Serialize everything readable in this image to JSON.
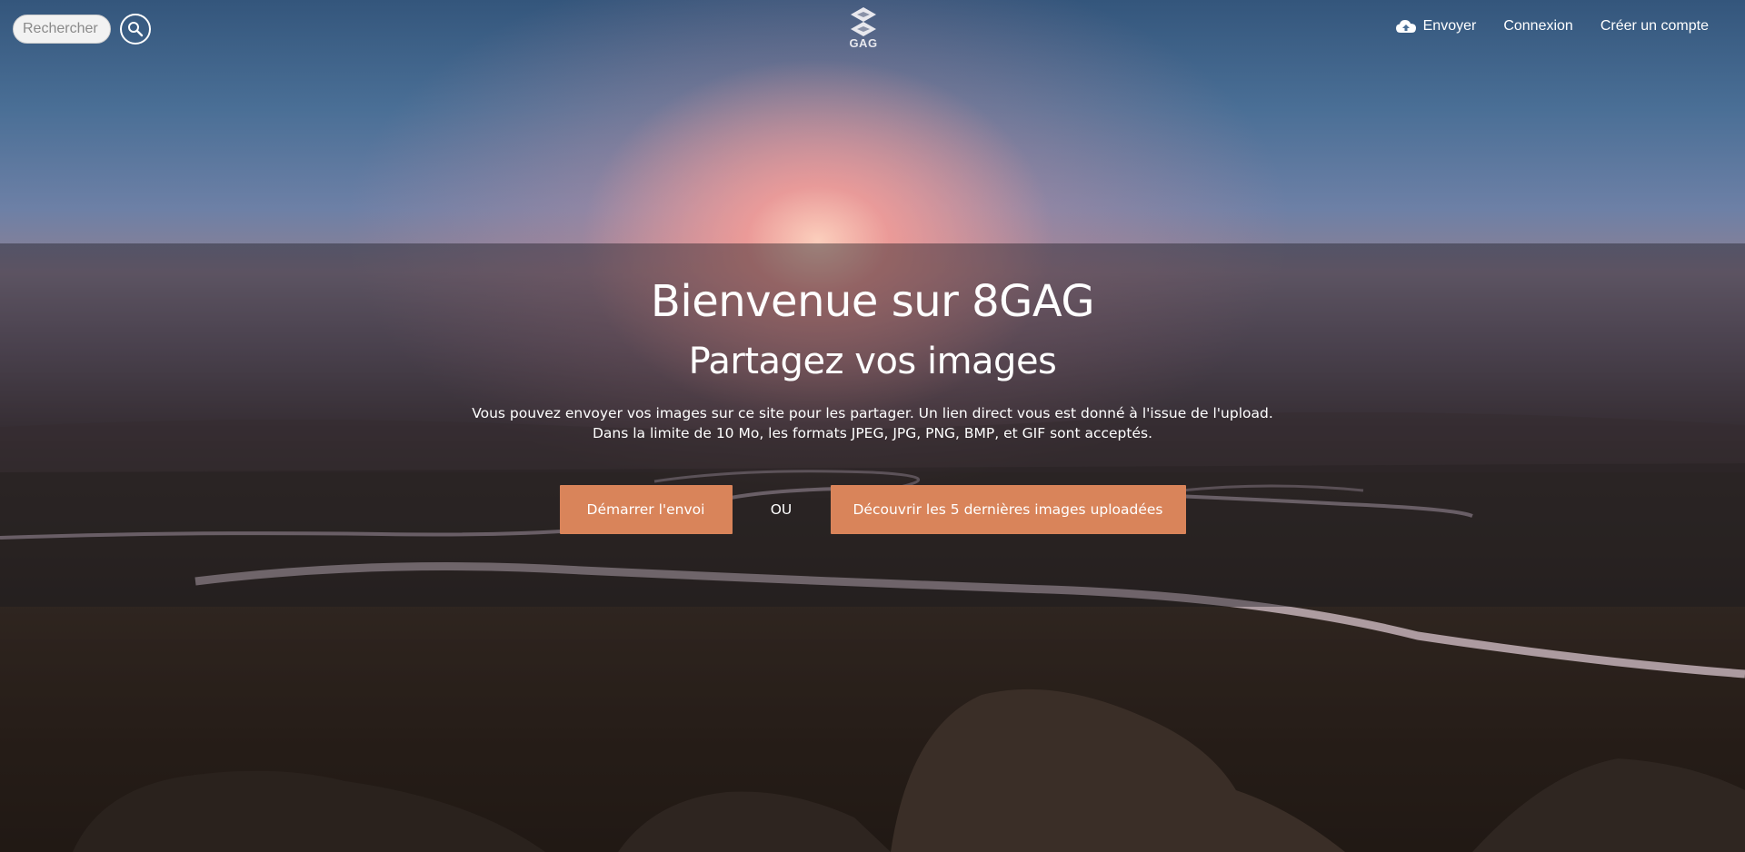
{
  "header": {
    "search": {
      "placeholder": "Rechercher",
      "value": "",
      "icon": "search-icon"
    },
    "logo": {
      "text": "GAG",
      "icon": "8gag-logo-icon"
    },
    "nav": {
      "upload_label": "Envoyer",
      "upload_icon": "cloud-upload-icon",
      "login_label": "Connexion",
      "signup_label": "Créer un compte"
    }
  },
  "hero": {
    "title": "Bienvenue sur 8GAG",
    "subtitle": "Partagez vos images",
    "description_line1": "Vous pouvez envoyer vos images sur ce site pour les partager. Un lien direct vous est donné à l'issue de l'upload.",
    "description_line2": "Dans la limite de 10 Mo, les formats JPEG, JPG, PNG, BMP, et GIF sont acceptés.",
    "start_button_label": "Démarrer l'envoi",
    "separator_label": "OU",
    "discover_button_label": "Découvrir les 5 dernières images uploadées"
  },
  "colors": {
    "accent": "#d9845a",
    "text": "#ffffff",
    "overlay": "rgba(25,25,30,0.42)"
  }
}
